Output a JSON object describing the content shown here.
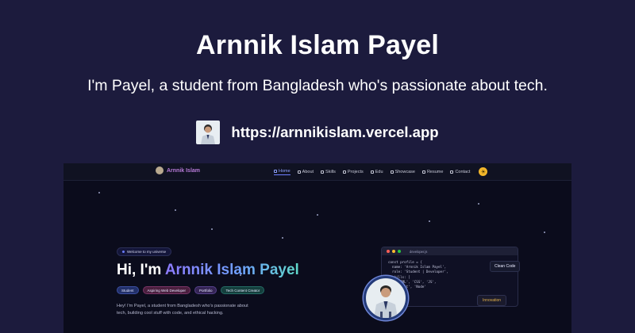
{
  "card": {
    "title": "Arnnik Islam Payel",
    "subtitle": "I'm Payel, a student from Bangladesh who's passionate about tech.",
    "url": "https://arnnikislam.vercel.app"
  },
  "preview": {
    "logo_text": "Arnnik Islam",
    "nav_items": [
      "Home",
      "About",
      "Skills",
      "Projects",
      "Edu",
      "Showcase",
      "Resume",
      "Contact"
    ],
    "theme_icon": "sun-icon",
    "welcome_badge": "Welcome to my universe",
    "hero_prefix": "Hi, I'm ",
    "hero_name": "Arnnik Islam Payel",
    "chips": [
      "Student",
      "Aspiring Web Developer",
      "Portfolio",
      "Tech Content Creator"
    ],
    "description": "Hey! I'm Payel, a student from Bangladesh who's passionate about tech, building cool stuff with code, and ethical hacking.",
    "code_filename": "developer.js",
    "code_lines": [
      "const profile = {",
      "  name: 'Arnnik Islam Payel',",
      "  role: 'Student | Developer',",
      "  skills: [",
      "    'HTML', 'CSS', 'JS',",
      "    'React', 'Node'",
      "  ]",
      "};"
    ],
    "clean_code_label": "Clean Code",
    "innovation_label": "Innovation",
    "colors": {
      "page_bg": "#1c1b3d",
      "preview_bg": "#0b0c1c",
      "accent": "#6f80ff",
      "theme_toggle": "#f2b62a"
    }
  }
}
